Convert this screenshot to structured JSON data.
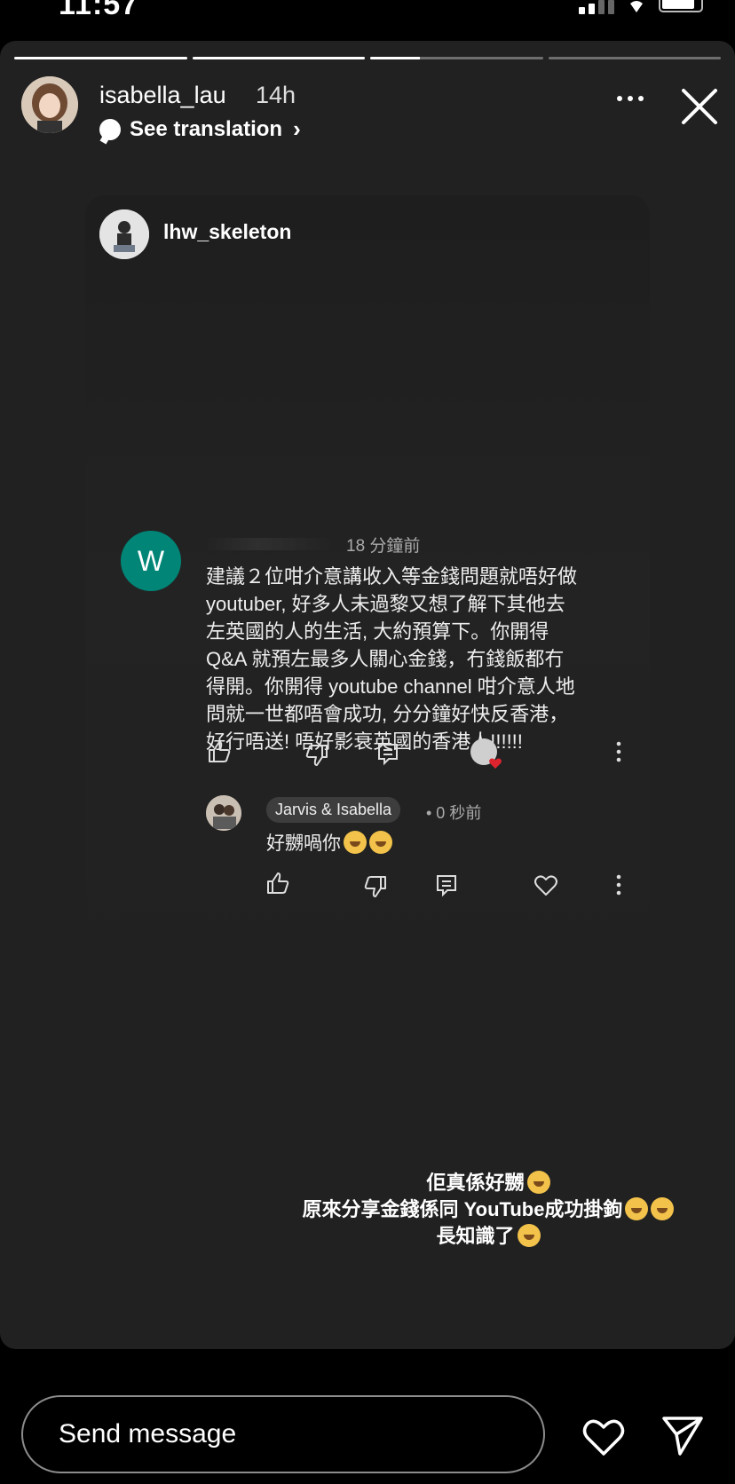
{
  "status_bar": {
    "time": "11:57",
    "signal_icon": "cellular-signal-icon",
    "wifi_icon": "wifi-icon",
    "battery_icon": "battery-icon"
  },
  "story": {
    "progress_segments": [
      {
        "fill": 1.0
      },
      {
        "fill": 1.0
      },
      {
        "fill": 0.29
      },
      {
        "fill": 0.0
      }
    ],
    "author": "isabella_lau",
    "time_ago": "14h",
    "translation_label": "See translation",
    "more_icon": "more-horizontal-icon",
    "close_icon": "close-icon"
  },
  "shared_post": {
    "username": "lhw_skeleton",
    "comment": {
      "avatar_letter": "W",
      "time": "18 分鐘前",
      "text": "建議２位咁介意講收入等金錢問題就唔好做\nyoutuber, 好多人未過黎又想了解下其他去\n左英國的人的生活, 大約預算下。你開得\nQ&A 就預左最多人關心金錢，冇錢飯都冇\n得開。你開得 youtube channel 咁介意人地\n問就一世都唔會成功, 分分鐘好快反香港，\n好行唔送! 唔好影衰英國的香港人!!!!!!",
      "action_icons": [
        "thumbs-up-icon",
        "thumbs-down-icon",
        "reply-icon",
        "creator-heart-icon",
        "more-vertical-icon"
      ]
    },
    "reply": {
      "author": "Jarvis & Isabella",
      "time": "• 0 秒前",
      "text": "好嬲喎你"
    }
  },
  "caption": {
    "lines": [
      "佢真係好嬲",
      "原來分享金錢係同 YouTube成功掛鉤",
      "長知識了"
    ]
  },
  "bottom_bar": {
    "placeholder": "Send message",
    "like_icon": "heart-icon",
    "send_icon": "send-icon"
  }
}
